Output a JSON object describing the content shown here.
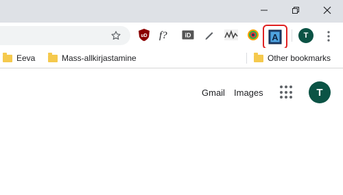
{
  "bookmarks": [
    {
      "label": "Eeva"
    },
    {
      "label": "Mass-allkirjastamine"
    },
    {
      "label": "Other bookmarks"
    }
  ],
  "toolbar": {
    "profile_initial": "T",
    "extensions": [
      "ublock-icon",
      "fquery-icon",
      "id-icon",
      "pencil-icon",
      "wave-icon",
      "eye-icon",
      "a-extension-icon"
    ],
    "highlight_color": "#e02020"
  },
  "page": {
    "gmail_label": "Gmail",
    "images_label": "Images",
    "avatar_initial": "T",
    "avatar_color": "#0b5345"
  }
}
